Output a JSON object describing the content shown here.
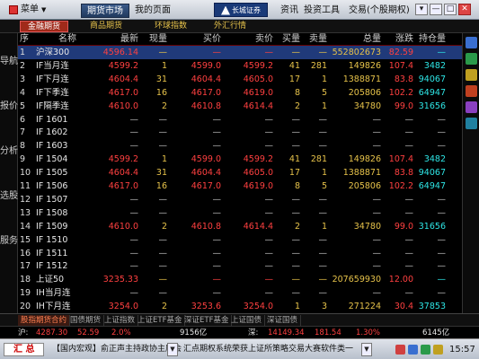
{
  "titlebar": {
    "menu_label": "菜单",
    "tabs": [
      "期货市场",
      "我的页面"
    ],
    "active_tab": 0,
    "logo_text": "长城证券",
    "menus": [
      "资讯",
      "投资工具",
      "交易(个股期权)"
    ],
    "win_buttons": [
      "▾",
      "—",
      "□",
      "✕"
    ]
  },
  "subtabs": [
    "金融期货",
    "商品期货",
    "环球指数",
    "外汇行情"
  ],
  "sidenav": [
    "导航",
    "报价",
    "分析",
    "选股",
    "服务"
  ],
  "table": {
    "columns": [
      "序",
      "名称",
      "最新",
      "现量",
      "买价",
      "卖价",
      "买量",
      "卖量",
      "总量",
      "涨跌",
      "持仓量"
    ],
    "rows": [
      {
        "idx": "1",
        "name": "沪深300",
        "last": "4596.14",
        "vol": "—",
        "bid": "—",
        "ask": "—",
        "bv": "—",
        "av": "—",
        "tot": "552802673",
        "chg": "82.59",
        "oi": "—",
        "dir": "up",
        "sel": true
      },
      {
        "idx": "2",
        "name": "IF当月连",
        "last": "4599.2",
        "vol": "1",
        "bid": "4599.0",
        "ask": "4599.2",
        "bv": "41",
        "av": "281",
        "tot": "149826",
        "chg": "107.4",
        "oi": "3482",
        "dir": "up"
      },
      {
        "idx": "3",
        "name": "IF下月连",
        "last": "4604.4",
        "vol": "31",
        "bid": "4604.4",
        "ask": "4605.0",
        "bv": "17",
        "av": "1",
        "tot": "1388871",
        "chg": "83.8",
        "oi": "94067",
        "dir": "up"
      },
      {
        "idx": "4",
        "name": "IF下季连",
        "last": "4617.0",
        "vol": "16",
        "bid": "4617.0",
        "ask": "4619.0",
        "bv": "8",
        "av": "5",
        "tot": "205806",
        "chg": "102.2",
        "oi": "64947",
        "dir": "up"
      },
      {
        "idx": "5",
        "name": "IF隔季连",
        "last": "4610.0",
        "vol": "2",
        "bid": "4610.8",
        "ask": "4614.4",
        "bv": "2",
        "av": "1",
        "tot": "34780",
        "chg": "99.0",
        "oi": "31656",
        "dir": "up"
      },
      {
        "idx": "6",
        "name": "IF 1601",
        "last": "—",
        "vol": "—",
        "bid": "—",
        "ask": "—",
        "bv": "—",
        "av": "—",
        "tot": "—",
        "chg": "—",
        "oi": "—",
        "dir": "none"
      },
      {
        "idx": "7",
        "name": "IF 1602",
        "last": "—",
        "vol": "—",
        "bid": "—",
        "ask": "—",
        "bv": "—",
        "av": "—",
        "tot": "—",
        "chg": "—",
        "oi": "—",
        "dir": "none"
      },
      {
        "idx": "8",
        "name": "IF 1603",
        "last": "—",
        "vol": "—",
        "bid": "—",
        "ask": "—",
        "bv": "—",
        "av": "—",
        "tot": "—",
        "chg": "—",
        "oi": "—",
        "dir": "none"
      },
      {
        "idx": "9",
        "name": "IF 1504",
        "last": "4599.2",
        "vol": "1",
        "bid": "4599.0",
        "ask": "4599.2",
        "bv": "41",
        "av": "281",
        "tot": "149826",
        "chg": "107.4",
        "oi": "3482",
        "dir": "up"
      },
      {
        "idx": "10",
        "name": "IF 1505",
        "last": "4604.4",
        "vol": "31",
        "bid": "4604.4",
        "ask": "4605.0",
        "bv": "17",
        "av": "1",
        "tot": "1388871",
        "chg": "83.8",
        "oi": "94067",
        "dir": "up"
      },
      {
        "idx": "11",
        "name": "IF 1506",
        "last": "4617.0",
        "vol": "16",
        "bid": "4617.0",
        "ask": "4619.0",
        "bv": "8",
        "av": "5",
        "tot": "205806",
        "chg": "102.2",
        "oi": "64947",
        "dir": "up"
      },
      {
        "idx": "12",
        "name": "IF 1507",
        "last": "—",
        "vol": "—",
        "bid": "—",
        "ask": "—",
        "bv": "—",
        "av": "—",
        "tot": "—",
        "chg": "—",
        "oi": "—",
        "dir": "none"
      },
      {
        "idx": "13",
        "name": "IF 1508",
        "last": "—",
        "vol": "—",
        "bid": "—",
        "ask": "—",
        "bv": "—",
        "av": "—",
        "tot": "—",
        "chg": "—",
        "oi": "—",
        "dir": "none"
      },
      {
        "idx": "14",
        "name": "IF 1509",
        "last": "4610.0",
        "vol": "2",
        "bid": "4610.8",
        "ask": "4614.4",
        "bv": "2",
        "av": "1",
        "tot": "34780",
        "chg": "99.0",
        "oi": "31656",
        "dir": "up"
      },
      {
        "idx": "15",
        "name": "IF 1510",
        "last": "—",
        "vol": "—",
        "bid": "—",
        "ask": "—",
        "bv": "—",
        "av": "—",
        "tot": "—",
        "chg": "—",
        "oi": "—",
        "dir": "none"
      },
      {
        "idx": "16",
        "name": "IF 1511",
        "last": "—",
        "vol": "—",
        "bid": "—",
        "ask": "—",
        "bv": "—",
        "av": "—",
        "tot": "—",
        "chg": "—",
        "oi": "—",
        "dir": "none"
      },
      {
        "idx": "17",
        "name": "IF 1512",
        "last": "—",
        "vol": "—",
        "bid": "—",
        "ask": "—",
        "bv": "—",
        "av": "—",
        "tot": "—",
        "chg": "—",
        "oi": "—",
        "dir": "none"
      },
      {
        "idx": "18",
        "name": "上证50",
        "last": "3235.33",
        "vol": "—",
        "bid": "—",
        "ask": "—",
        "bv": "—",
        "av": "—",
        "tot": "207659930",
        "chg": "12.00",
        "oi": "—",
        "dir": "up"
      },
      {
        "idx": "19",
        "name": "IH当月连",
        "last": "—",
        "vol": "—",
        "bid": "—",
        "ask": "—",
        "bv": "—",
        "av": "—",
        "tot": "—",
        "chg": "—",
        "oi": "—",
        "dir": "none"
      },
      {
        "idx": "20",
        "name": "IH下月连",
        "last": "3254.0",
        "vol": "2",
        "bid": "3253.6",
        "ask": "3254.0",
        "bv": "1",
        "av": "3",
        "tot": "271224",
        "chg": "30.4",
        "oi": "37853",
        "dir": "up"
      }
    ]
  },
  "bottom_tabs": [
    "股指期货合约",
    "国债期货",
    "上证指数",
    "上证ETF基金",
    "深证ETF基金",
    "上证国债",
    "深证国债"
  ],
  "index_strip": {
    "sh_label": "沪:",
    "sh_val": "4287.30",
    "sh_chg": "52.59",
    "sh_pct": "2.0%",
    "sh_amt": "9156亿",
    "sz_label": "深:",
    "sz_val": "14149.34",
    "sz_chg": "181.54",
    "sz_pct": "1.30%",
    "sz_amt": "6145亿"
  },
  "status": {
    "sum_label": "汇 总",
    "news_left": "【国内宏观】俞正声主持政协主席会",
    "news_right": "汇点期权系统荣获上证所策略交易大赛软件类一",
    "clock": "15:57"
  },
  "colors": {
    "up": "#ff4040",
    "down": "#30e030",
    "accent": "#a02a1a",
    "cyan": "#2ee6e6",
    "yellow": "#e6c24a"
  }
}
